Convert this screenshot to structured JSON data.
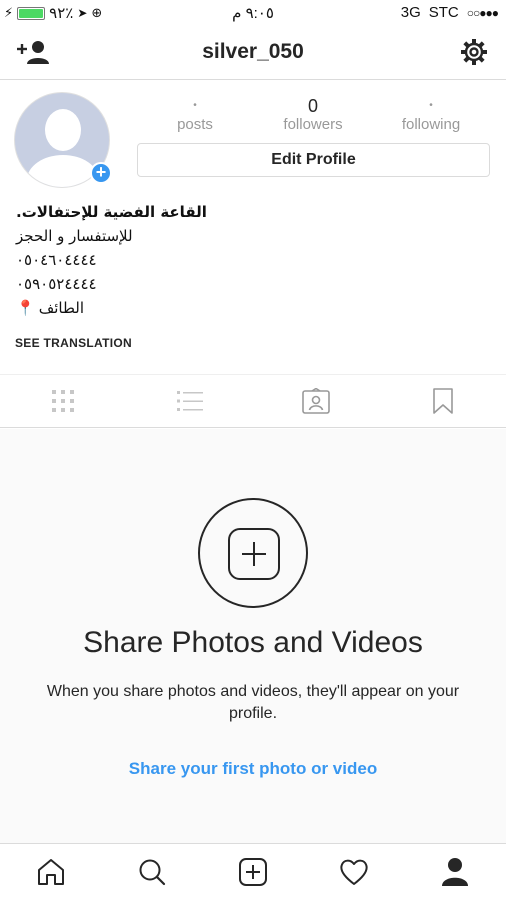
{
  "status_bar": {
    "battery": "٩٢٪",
    "time": "٩:٠٥ م",
    "network": "3G",
    "carrier": "STC",
    "signal_dots": "○○●●●"
  },
  "header": {
    "username": "silver_050"
  },
  "profile": {
    "stats": [
      {
        "value": "•",
        "label": "posts"
      },
      {
        "value": "0",
        "label": "followers"
      },
      {
        "value": "•",
        "label": "following"
      }
    ],
    "edit_label": "Edit Profile",
    "bio_lines": [
      "القاعة الفضية للإحتفالات.",
      "للإستفسار و الحجز",
      "٠٥٠٤٦٠٤٤٤٤",
      "٠٥٩٠٥٢٤٤٤٤",
      "الطائف"
    ],
    "see_translation": "SEE TRANSLATION"
  },
  "tabs": [
    "grid-tab",
    "list-tab",
    "tagged-tab",
    "saved-tab"
  ],
  "empty_state": {
    "title": "Share Photos and Videos",
    "subtitle": "When you share photos and videos, they'll appear on your profile.",
    "cta": "Share your first photo or video"
  },
  "bottom_nav": [
    "home",
    "search",
    "add",
    "activity",
    "profile"
  ],
  "colors": {
    "accent": "#3897f0",
    "text": "#262626",
    "muted": "#999999",
    "pin": "#d9342b"
  }
}
